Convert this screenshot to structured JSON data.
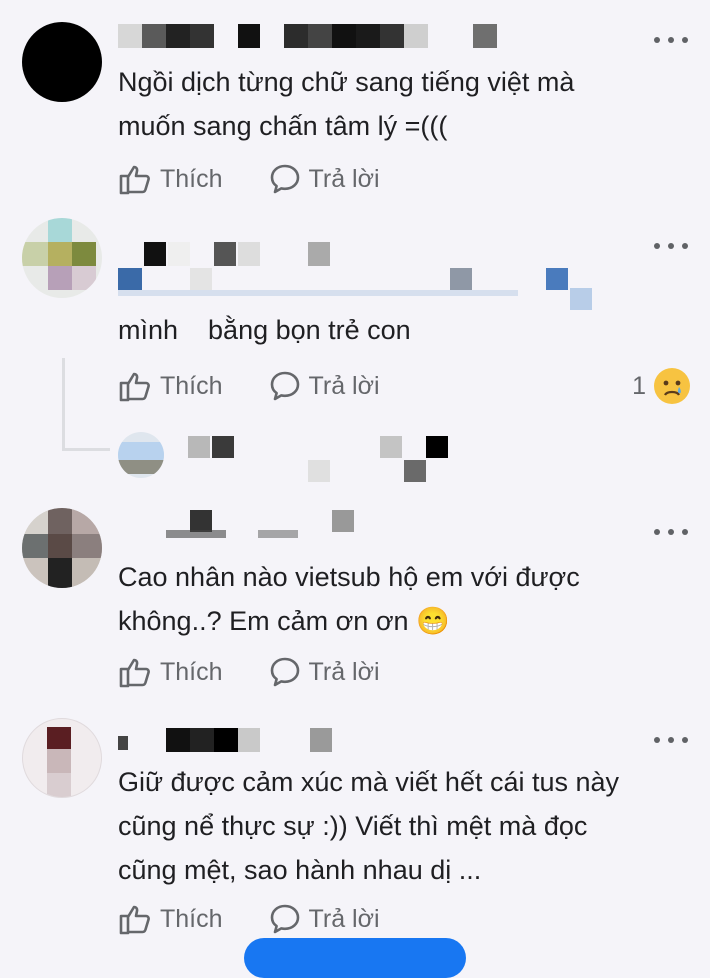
{
  "comments": [
    {
      "text_lines": [
        "Ngồi dịch từng chữ sang tiếng việt mà",
        "muốn sang chấn tâm lý =((("
      ],
      "like_label": "Thích",
      "reply_label": "Trả lời"
    },
    {
      "text_lines": [
        "mình    bằng bọn trẻ con"
      ],
      "like_label": "Thích",
      "reply_label": "Trả lời",
      "reaction_count": "1",
      "reaction_icon": "crying-face-icon"
    },
    {
      "text_lines": [
        "Cao nhân nào vietsub hộ em với được",
        "không..? Em cảm ơn ơn 😁"
      ],
      "like_label": "Thích",
      "reply_label": "Trả lời"
    },
    {
      "text_lines": [
        "Giữ được cảm xúc mà viết hết cái tus này",
        "cũng nể thực sự :)) Viết thì mệt mà đọc",
        "cũng mệt, sao hành nhau dị ..."
      ],
      "like_label": "Thích",
      "reply_label": "Trả lời"
    }
  ],
  "colors": {
    "background": "#f5f4f9",
    "text": "#1f1f22",
    "secondary_text": "#65676b",
    "accent": "#1877f2"
  }
}
